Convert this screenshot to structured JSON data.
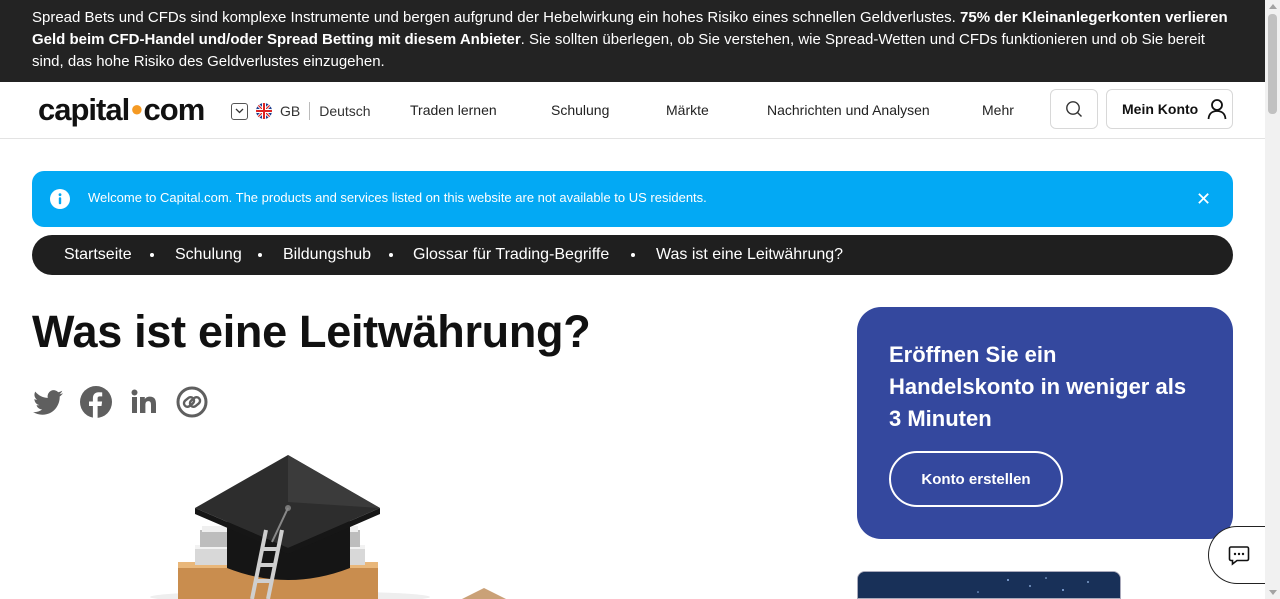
{
  "risk_warning": {
    "part1": "Spread Bets und CFDs sind komplexe Instrumente und bergen aufgrund der Hebelwirkung ein hohes Risiko eines schnellen Geldverlustes. ",
    "bold": "75% der Kleinanlegerkonten verlieren Geld beim CFD-Handel und/oder Spread Betting mit diesem Anbieter",
    "part2": ". Sie sollten überlegen, ob Sie verstehen, wie Spread-Wetten und CFDs funktionieren und ob Sie bereit sind, das hohe Risiko des Geldverlustes einzugehen."
  },
  "header": {
    "logo_left": "capital",
    "logo_dot": "●",
    "logo_right": "com",
    "region": "GB",
    "language": "Deutsch",
    "nav": [
      "Traden lernen",
      "Schulung",
      "Märkte",
      "Nachrichten und Analysen",
      "Mehr"
    ],
    "account_label": "Mein Konto"
  },
  "notice": {
    "message": "Welcome to Capital.com. The products and services listed on this website are not available to US residents.",
    "close": "✕"
  },
  "breadcrumb": [
    "Startseite",
    "Schulung",
    "Bildungshub",
    "Glossar für Trading-Begriffe",
    "Was ist eine Leitwährung?"
  ],
  "article": {
    "title": "Was ist eine Leitwährung?",
    "share_icons": [
      "twitter-icon",
      "facebook-icon",
      "linkedin-icon",
      "copy-link-icon"
    ]
  },
  "promo": {
    "heading": "Eröffnen Sie ein Handelskonto in weniger als 3 Minuten",
    "button": "Konto erstellen"
  },
  "colors": {
    "risk_bar": "#232323",
    "notice": "#03a9f4",
    "breadcrumb": "#1f1f1f",
    "promo": "#34489e",
    "logo_dot": "#f59a23",
    "share_icon": "#5f5f5f"
  }
}
